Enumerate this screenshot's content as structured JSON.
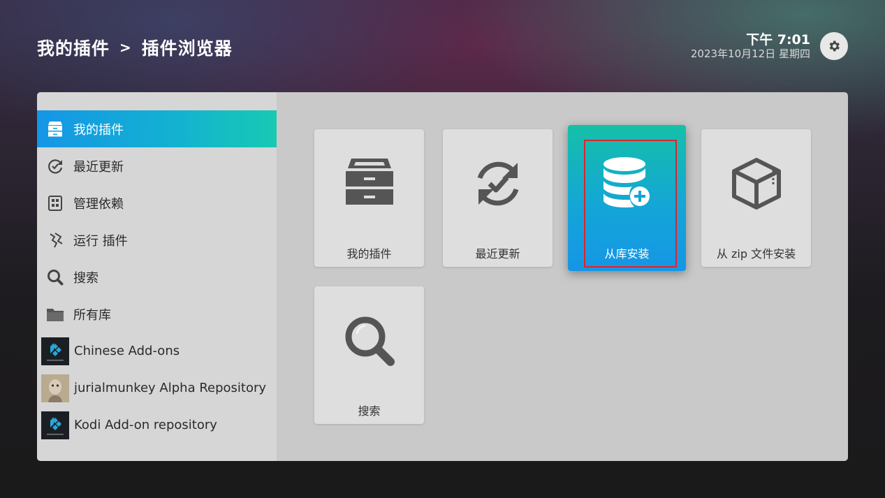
{
  "header": {
    "breadcrumb": [
      "我的插件",
      "插件浏览器"
    ],
    "separator": ">",
    "time": "下午 7:01",
    "date": "2023年10月12日 星期四"
  },
  "sidebar": {
    "items": [
      {
        "label": "我的插件",
        "icon": "addon-box-icon",
        "active": true
      },
      {
        "label": "最近更新",
        "icon": "recent-update-icon"
      },
      {
        "label": "管理依赖",
        "icon": "dependencies-icon"
      },
      {
        "label": "运行 插件",
        "icon": "run-addon-icon"
      },
      {
        "label": "搜索",
        "icon": "search-icon"
      },
      {
        "label": "所有库",
        "icon": "folder-icon"
      },
      {
        "label": "Chinese Add-ons",
        "icon": "kodi-thumb"
      },
      {
        "label": "jurialmunkey Alpha Repository",
        "icon": "avatar-thumb"
      },
      {
        "label": "Kodi Add-on repository",
        "icon": "kodi-thumb"
      }
    ]
  },
  "tiles": [
    {
      "label": "我的插件",
      "icon": "addon-box-icon"
    },
    {
      "label": "最近更新",
      "icon": "recent-update-icon"
    },
    {
      "label": "从库安装",
      "icon": "database-add-icon",
      "focused": true
    },
    {
      "label": "从 zip 文件安装",
      "icon": "zip-package-icon"
    },
    {
      "label": "搜索",
      "icon": "search-icon"
    }
  ],
  "colors": {
    "accent_start": "#1596e6",
    "accent_end": "#18c9b2",
    "focus_outline": "#d9262c"
  }
}
